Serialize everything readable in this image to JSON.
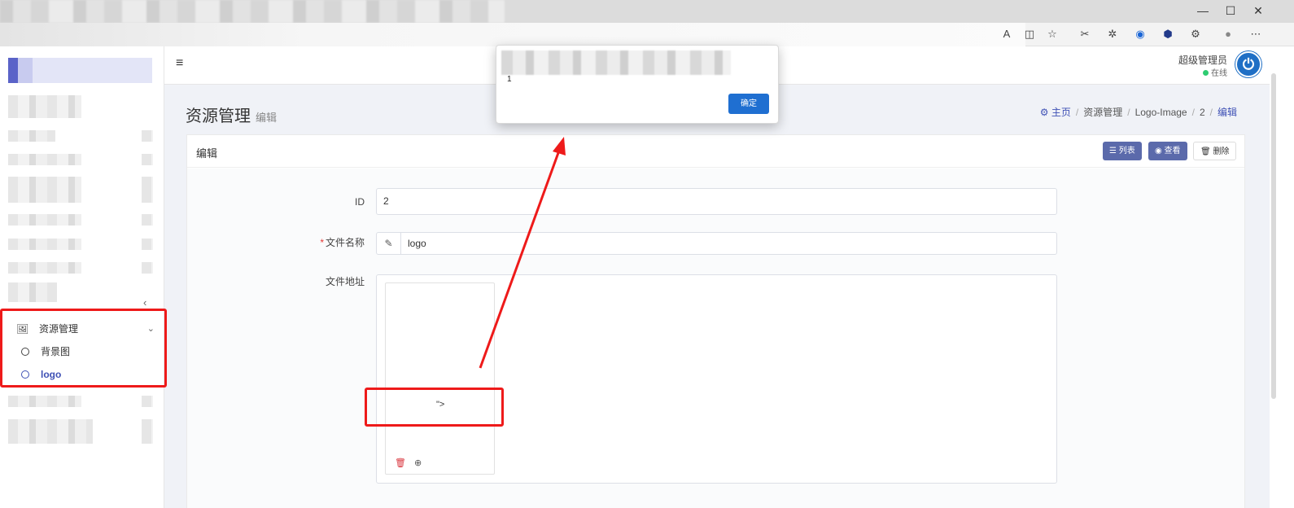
{
  "window_controls": {
    "minimize": "—",
    "maximize": "☐",
    "close": "✕"
  },
  "toolbar_icons": [
    "read-aloud-icon",
    "split-screen-icon",
    "favorite-icon",
    "tools-icon",
    "extension-icon",
    "circle-extension-icon",
    "hex-extension-icon",
    "puzzle-icon",
    "profile-icon",
    "more-icon"
  ],
  "sidebar": {
    "collapse_glyph": "‹",
    "menu": {
      "label": "资源管理",
      "chevron": "⌄"
    },
    "sub_items": [
      {
        "label": "背景图",
        "active": false
      },
      {
        "label": "logo",
        "active": true
      }
    ]
  },
  "header": {
    "hamburger": "≡",
    "user_name": "超级管理员",
    "user_status": "在线",
    "avatar_glyph": "⏻"
  },
  "page": {
    "title": "资源管理",
    "subtitle": "编辑",
    "breadcrumb": {
      "home": "主页",
      "items": [
        "资源管理",
        "Logo-Image",
        "2"
      ],
      "current": "编辑",
      "separator": "/"
    }
  },
  "card": {
    "title": "编辑",
    "buttons": {
      "list": "☰ 列表",
      "view": "◉ 查看",
      "delete": "🗑 删除"
    }
  },
  "form": {
    "id_label": "ID",
    "id_value": "2",
    "filename_label": "文件名称",
    "filename_required": "*",
    "filename_value": "logo",
    "filename_prefix_icon": "✎",
    "fileaddr_label": "文件地址",
    "thumb_text": "\">",
    "thumb_delete_icon": "🗑",
    "thumb_zoom_icon": "⊕"
  },
  "dialog": {
    "message": "1",
    "ok_label": "确定"
  },
  "colors": {
    "accent": "#3f51b5",
    "button": "#5b6aab",
    "dialog_button": "#1f6fd1",
    "annotation": "#ee1a1a"
  }
}
